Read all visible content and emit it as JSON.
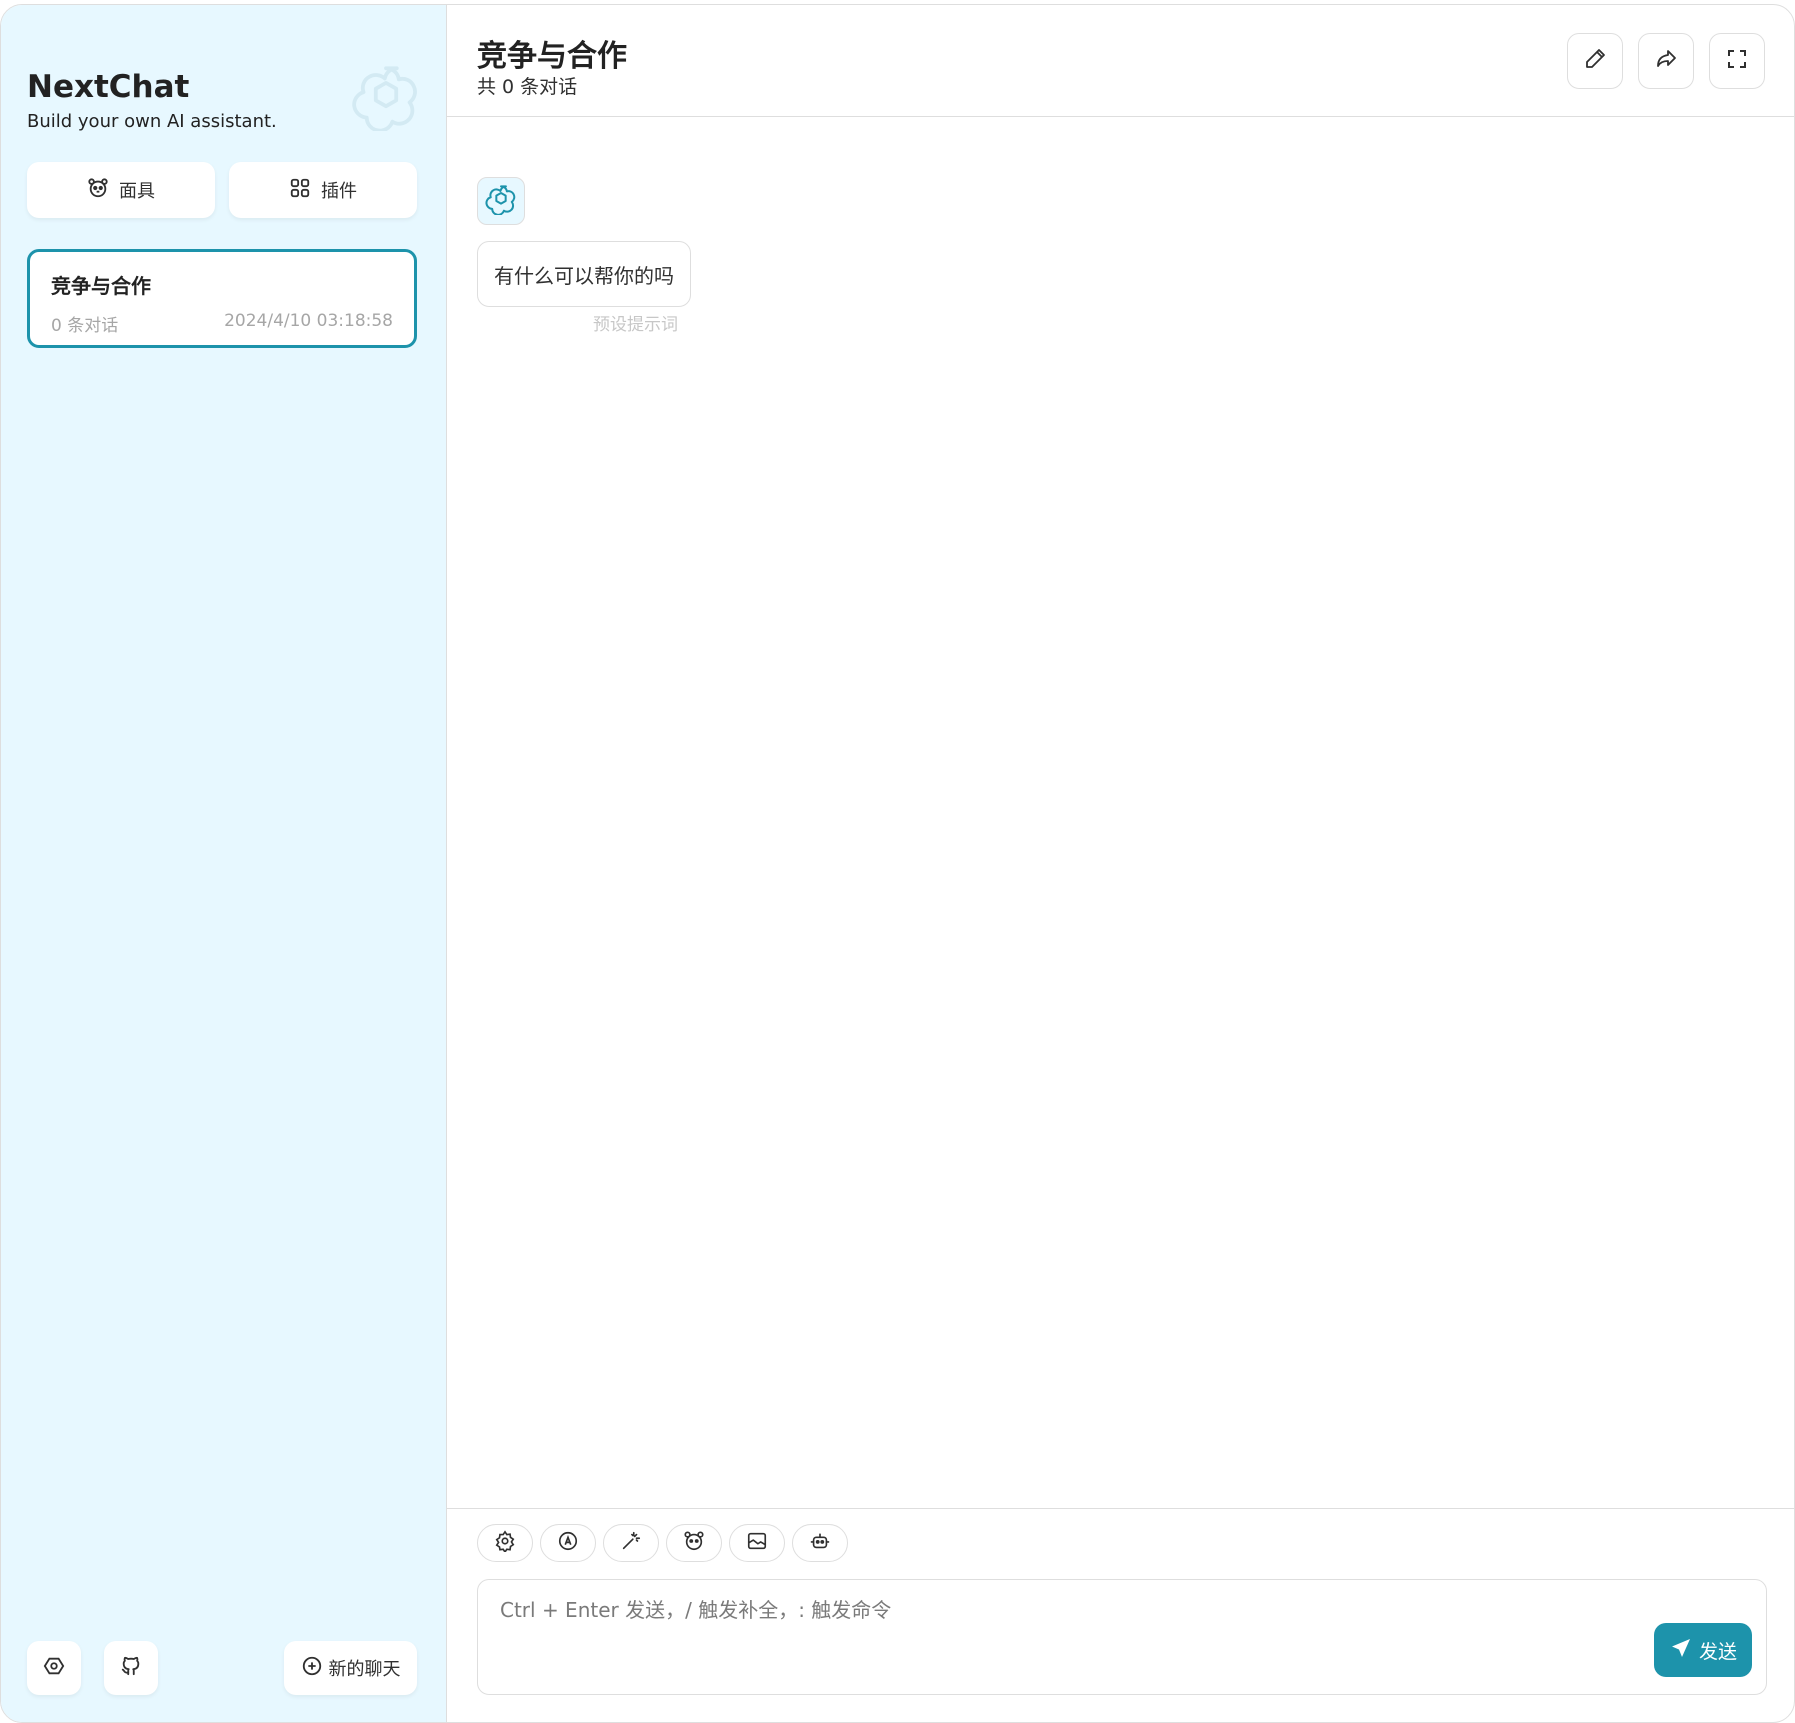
{
  "sidebar": {
    "title": "NextChat",
    "subtitle": "Build your own AI assistant.",
    "logo_icon": "openai-logo-icon",
    "mask_button_label": "面具",
    "plugin_button_label": "插件",
    "chats": [
      {
        "title": "竞争与合作",
        "count": "0 条对话",
        "date": "2024/4/10 03:18:58",
        "selected": true
      }
    ],
    "settings_icon": "settings-icon",
    "github_icon": "github-icon",
    "new_chat_label": "新的聊天"
  },
  "header": {
    "title": "竞争与合作",
    "subtitle": "共 0 条对话",
    "buttons": [
      "edit-icon",
      "share-icon",
      "fullscreen-icon"
    ]
  },
  "messages": [
    {
      "role": "assistant",
      "avatar": "openai-logo-icon",
      "text": "有什么可以帮你的吗",
      "meta": "预设提示词"
    }
  ],
  "input": {
    "tools": [
      "settings-icon",
      "theme-auto-icon",
      "prompt-magic-icon",
      "mask-icon",
      "image-icon",
      "robot-icon"
    ],
    "placeholder": "Ctrl + Enter 发送，/ 触发补全，: 触发命令",
    "value": "",
    "send_label": "发送"
  },
  "colors": {
    "accent": "#1d93ab",
    "sidebar_bg": "#e7f8ff",
    "border": "#dedede"
  }
}
